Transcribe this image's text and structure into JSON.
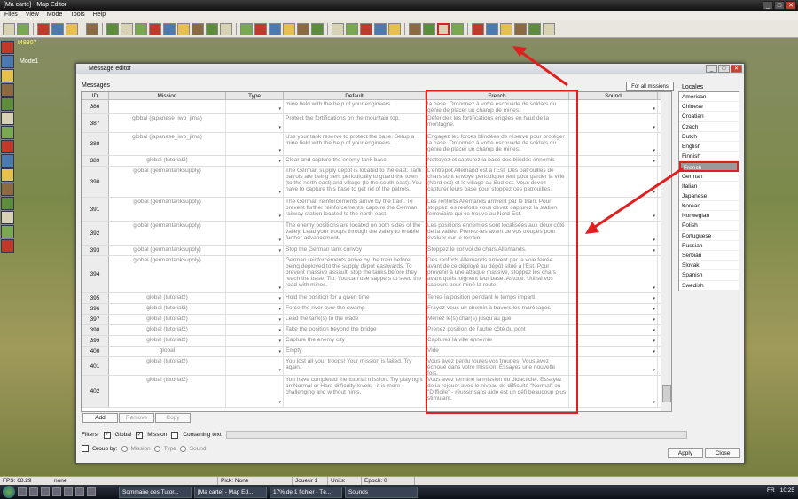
{
  "app": {
    "title": "[Ma carte] - Map Editor"
  },
  "menu": [
    "Files",
    "View",
    "Mode",
    "Tools",
    "Help"
  ],
  "viewport": {
    "coord": "t48307",
    "mode": "Mode1"
  },
  "dialog": {
    "title": "Message editor",
    "messages_label": "Messages",
    "all_missions_btn": "For all missions",
    "locales_label": "Locales",
    "columns": [
      "ID",
      "Mission",
      "Type",
      "Default",
      "French",
      "Sound"
    ],
    "rows": [
      {
        "id": "386",
        "mission": "",
        "default": "mine field with the help of your engineers.",
        "french": "la base. Ordonnez à votre escouade de soldats du génie de placer un champ de mines.",
        "h": 16
      },
      {
        "id": "387",
        "mission": "global (japanese_iwo_jima)",
        "default": "Protect the fortifications on the mountain top.",
        "french": "Défendez les fortifications érigées en haut de la montagne.",
        "h": 21
      },
      {
        "id": "388",
        "mission": "global (japanese_iwo_jima)",
        "default": "Use your tank reserve to protect the base. Setup a mine field with the help of your engineers.",
        "french": "Engagez les forces blindées de réserve pour protéger la base. Ordonnez à votre escouade de soldats du génie de placer un champ de mines.",
        "h": 26
      },
      {
        "id": "389",
        "mission": "global (tutorial2)",
        "default": "Clear and capture the enemy tank base",
        "french": "Nettoyez et capturez la base des blindés ennemis",
        "h": 12
      },
      {
        "id": "390",
        "mission": "global (germantanksupply)",
        "default": "The German supply depot is located to the east. Tank patrols are being sent periodically to guard the town (to the north-east) and village (to the south-east). You have to capture this base to get rid of the patrols.",
        "french": "L'entrepôt Allemand est à l'Est. Des patrouilles de chars sont envoyé périodiquement pour garder la ville (Nord-est) et le village au Sud-est. Vous devez capturer leurs base pour stoppez ces patrouilles.",
        "h": 35
      },
      {
        "id": "391",
        "mission": "global (germantanksupply)",
        "default": "The German reinforcements arrive by the train. To prevent further reinforcements, capture the German railway station located to the north-east.",
        "french": "Les renforts Allemands arrivent par le train. Pour stoppez les renforts vous devez capturez la station ferroviaire qui ce trouve au Nord-Est.",
        "h": 27
      },
      {
        "id": "392",
        "mission": "global (germantanksupply)",
        "default": "The enemy positions are located on both sides of the valley. Lead your troops through the valley to enable further advancement.",
        "french": "Les positions ennemies sont localisées aux deux côté de la vallée. Prenez-les avant de vos troupes pour évoluer sur le terrain.",
        "h": 27
      },
      {
        "id": "393",
        "mission": "global (germantanksupply)",
        "default": "Stop the German tank convoy",
        "french": "Stoppez le convoi de chars Allemands.",
        "h": 12
      },
      {
        "id": "394",
        "mission": "global (germantanksupply)",
        "default": "German reinforcements arrive by the train before being deployed to the supply depot eastwards. To prevent massive assault, stop the tanks before they reach the base. Tip: You can use sappers to seed the road with mines.",
        "french": "Des renforts Allemands arrivent par la voie ferrée avant de ce déployé au dépôt situé à l'Est. Pour prévenir à une attaque massive, stoppez les chars avant qu'ils joignent leur base. Astuce: Utilisé vos sapeurs pour miné la route.",
        "h": 42
      },
      {
        "id": "395",
        "mission": "global (tutorial2)",
        "default": "Hold the position for a given time",
        "french": "Tenez la position pendant le temps imparti",
        "h": 12
      },
      {
        "id": "396",
        "mission": "global (tutorial2)",
        "default": "Force the river over the swamp",
        "french": "Frayez-vous un chemin à travers les marécages",
        "h": 12
      },
      {
        "id": "397",
        "mission": "global (tutorial2)",
        "default": "Lead the tank(s) to the wade",
        "french": "Menez le(s) char(s) jusqu'au gué",
        "h": 12
      },
      {
        "id": "398",
        "mission": "global (tutorial2)",
        "default": "Take the position beyond the bridge",
        "french": "Prenez position de l'autre côté du pont",
        "h": 12
      },
      {
        "id": "399",
        "mission": "global (tutorial2)",
        "default": "Capture the enemy city",
        "french": "Capturez la ville ennemie",
        "h": 12
      },
      {
        "id": "400",
        "mission": "global",
        "default": "Empty",
        "french": "Vide",
        "h": 12
      },
      {
        "id": "401",
        "mission": "global (tutorial2)",
        "default": "You lost all your troops! Your mission is failed. Try again.",
        "french": "Vous avez perdu toutes vos troupes! Vous avez échoué dans votre mission. Essayez une nouvelle fois.",
        "h": 21
      },
      {
        "id": "402",
        "mission": "global (tutorial2)",
        "default": "You have completed the tutorial mission. Try playing it on Normal or Hard difficulty levels - it is more challenging and without hints.",
        "french": "Vous avez terminé la mission du didacticiel. Essayez de la rejouer avec le niveau de difficulté \"Normal\" ou \"Difficile\" - réussir sans aide est un défi beaucoup plus stimulant.",
        "h": 36
      }
    ],
    "locales": [
      "American",
      "Chinese",
      "Croatian",
      "Czech",
      "Dutch",
      "English",
      "Finnish",
      "French",
      "German",
      "Italian",
      "Japanese",
      "Korean",
      "Norwegian",
      "Polish",
      "Portuguese",
      "Russian",
      "Serbian",
      "Slovak",
      "Spanish",
      "Swedish"
    ],
    "selected_locale": "French",
    "buttons": {
      "add": "Add",
      "remove": "Remove",
      "copy": "Copy",
      "apply": "Apply",
      "close": "Close"
    },
    "filters": {
      "label": "Filters:",
      "global": "Global",
      "mission": "Mission",
      "containing": "Containing text"
    },
    "groupby": {
      "label": "Group by:",
      "mission": "Mission",
      "type": "Type",
      "sound": "Sound"
    }
  },
  "statusbar": {
    "fps": "FPS: 68.29",
    "sel": "none",
    "pick": "Pick: None",
    "player": "Joueur 1 (1)",
    "units": "Units:",
    "epoch": "Epoch: 0"
  },
  "taskbar": {
    "tasks": [
      "Sommaire des Tutor...",
      "[Ma carte] - Map Ed...",
      "17% de 1 fichier - Té...",
      "Sounds"
    ],
    "lang": "FR",
    "clock": "10:25"
  },
  "colors": {
    "highlight": "#e02020"
  }
}
